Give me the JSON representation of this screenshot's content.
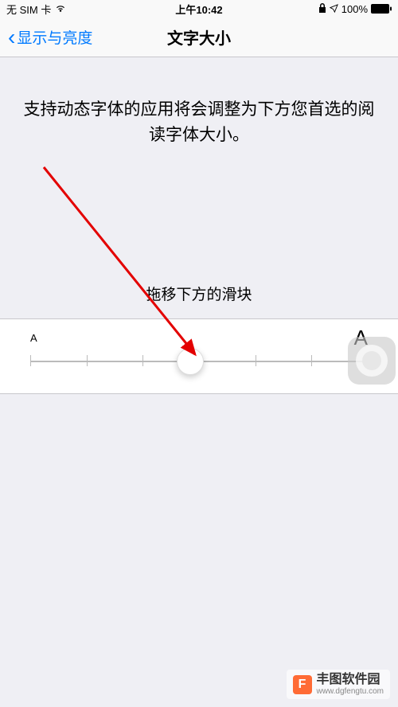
{
  "status": {
    "carrier": "无 SIM 卡",
    "time": "上午10:42",
    "battery": "100%"
  },
  "nav": {
    "back_label": "显示与亮度",
    "title": "文字大小"
  },
  "description": "支持动态字体的应用将会调整为下方您首选的阅读字体大小。",
  "slider": {
    "label": "拖移下方的滑块",
    "small_a": "A",
    "large_a": "A",
    "steps": 7,
    "current_step": 3
  },
  "watermark": {
    "logo": "F",
    "title": "丰图软件园",
    "url": "www.dgfengtu.com"
  }
}
